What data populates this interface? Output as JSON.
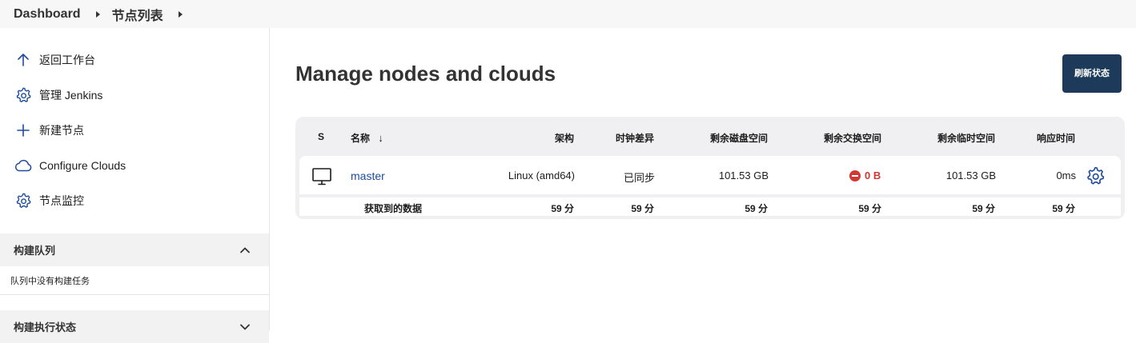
{
  "breadcrumb": {
    "items": [
      "Dashboard",
      "节点列表"
    ]
  },
  "sidebar": {
    "items": [
      {
        "label": "返回工作台",
        "icon": "arrow-up-icon"
      },
      {
        "label": "管理 Jenkins",
        "icon": "gear-icon"
      },
      {
        "label": "新建节点",
        "icon": "plus-icon"
      },
      {
        "label": "Configure Clouds",
        "icon": "cloud-icon"
      },
      {
        "label": "节点监控",
        "icon": "gear-icon"
      }
    ],
    "build_queue": {
      "title": "构建队列",
      "empty_text": "队列中没有构建任务"
    },
    "executor_status": {
      "title": "构建执行状态"
    }
  },
  "main": {
    "title": "Manage nodes and clouds",
    "refresh_label": "刷新状态"
  },
  "table": {
    "headers": {
      "status": "S",
      "name": "名称",
      "sort_indicator": "↓",
      "arch": "架构",
      "clock": "时钟差异",
      "disk": "剩余磁盘空间",
      "swap": "剩余交换空间",
      "temp": "剩余临时空间",
      "response": "响应时间"
    },
    "rows": [
      {
        "name": "master",
        "arch": "Linux (amd64)",
        "clock": "已同步",
        "disk": "101.53 GB",
        "swap": "0 B",
        "temp": "101.53 GB",
        "response": "0ms"
      }
    ],
    "footer": {
      "label": "获取到的数据",
      "arch": "59 分",
      "clock": "59 分",
      "disk": "59 分",
      "swap": "59 分",
      "temp": "59 分",
      "response": "59 分"
    }
  },
  "colors": {
    "accent": "#1e3a5a",
    "link": "#1f4b9c",
    "danger": "#d33833"
  }
}
